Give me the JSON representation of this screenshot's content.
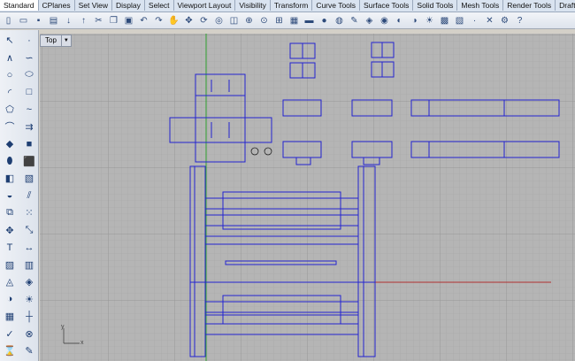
{
  "tabs": [
    "Standard",
    "CPlanes",
    "Set View",
    "Display",
    "Select",
    "Viewport Layout",
    "Visibility",
    "Transform",
    "Curve Tools",
    "Surface Tools",
    "Solid Tools",
    "Mesh Tools",
    "Render Tools",
    "Drafting"
  ],
  "active_tab": "Standard",
  "toolbar_icons": [
    "new-file-icon",
    "open-folder-icon",
    "save-icon",
    "print-icon",
    "import-icon",
    "export-icon",
    "cut-icon",
    "copy-icon",
    "paste-icon",
    "undo-icon",
    "redo-icon",
    "pan-hand-icon",
    "move-view-icon",
    "rotate-view-icon",
    "zoom-icon",
    "zoom-window-icon",
    "zoom-extents-icon",
    "zoom-selected-icon",
    "zoom-all-icon",
    "grid-icon",
    "car-icon",
    "bulb-icon",
    "sphere-icon",
    "properties-icon",
    "layer-icon",
    "color-wheel-icon",
    "shaded-icon",
    "render-icon",
    "light-icon",
    "texture-icon",
    "mesh-icon",
    "point-icon",
    "trim-icon",
    "options-icon",
    "help-icon"
  ],
  "left_tool_icons": [
    "select-arrow-icon",
    "point-icon",
    "polyline-icon",
    "curve-icon",
    "circle-icon",
    "ellipse-icon",
    "arc-icon",
    "rectangle-icon",
    "polygon-icon",
    "free-curve-icon",
    "fillet-icon",
    "offset-icon",
    "surface-icon",
    "box-icon",
    "cylinder-icon",
    "extrude-icon",
    "boolean-icon",
    "mesh-icon",
    "blend-icon",
    "split-icon",
    "group-icon",
    "array-icon",
    "move-icon",
    "scale-icon",
    "text-icon",
    "dimension-icon",
    "hatch-icon",
    "block-icon",
    "analyze-icon",
    "layer-icon",
    "render-icon",
    "light-icon",
    "grid-snap-icon",
    "ortho-icon",
    "check-icon",
    "osnap-icon",
    "history-icon",
    "properties-icon"
  ],
  "viewport": {
    "title": "Top"
  },
  "axis": {
    "x": "x",
    "y": "y"
  },
  "colors": {
    "grid_bg": "#b5b5b5",
    "grid_line": "#a6a6a6",
    "grid_major": "#969696",
    "curve": "#2424d0",
    "x_axis": "#b03030",
    "y_axis": "#2e9e2e"
  }
}
